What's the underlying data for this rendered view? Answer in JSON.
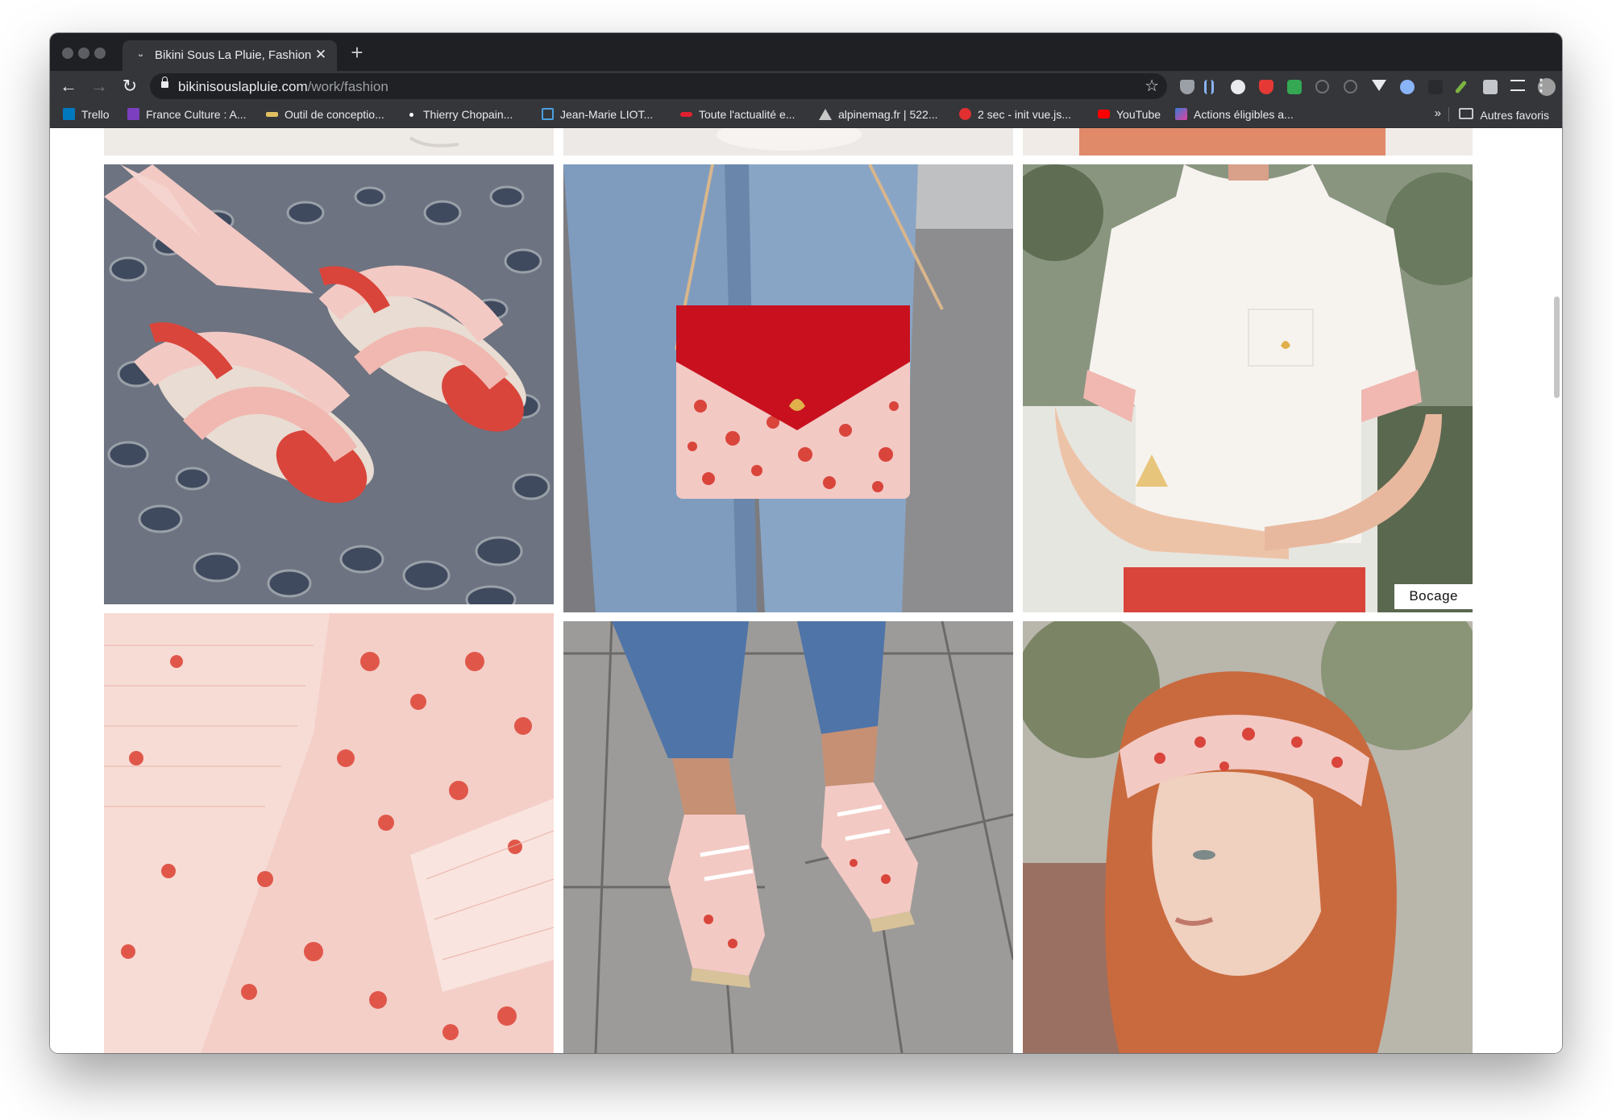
{
  "browser": {
    "tab": {
      "title": "Bikini Sous La Pluie, Fashion",
      "favicon": "mustache-icon",
      "close": "✕",
      "new_tab": "+"
    },
    "nav": {
      "back": "←",
      "forward": "→",
      "reload": "↻"
    },
    "address": {
      "host": "bikinisouslapluie.com",
      "path": "/work/fashion"
    },
    "star": "☆",
    "menu": "⋮",
    "extensions": [
      "shield-badge-0",
      "bar-chart",
      "skull",
      "red-shield",
      "green-badge-2",
      "recycle",
      "clock",
      "v-logo",
      "blue-ring",
      "dark-square",
      "pencil",
      "puzzle",
      "playlist",
      "profile-avatar"
    ]
  },
  "bookmarks": {
    "items": [
      {
        "label": "Trello",
        "icon_color": "#0079bf"
      },
      {
        "label": "France Culture : A...",
        "icon_color": "#7b3fbf"
      },
      {
        "label": "Outil de conceptio...",
        "icon_color": "#e0c060"
      },
      {
        "label": "Thierry Chopain...",
        "icon_color": "#ffffff"
      },
      {
        "label": "Jean-Marie LIOT...",
        "icon_color": "#4aa0e0"
      },
      {
        "label": "Toute l'actualité e...",
        "icon_color": "#e02030"
      },
      {
        "label": "alpinemag.fr | 522...",
        "icon_color": "#c8c8c8"
      },
      {
        "label": "2 sec - init vue.js...",
        "icon_color": "#e03030"
      },
      {
        "label": "YouTube",
        "icon_color": "#ff0000"
      },
      {
        "label": "Actions éligibles a...",
        "icon_color": "#e040a0"
      }
    ],
    "overflow": "»",
    "other_folder": "Autres favoris"
  },
  "gallery": {
    "captions": {
      "tshirt": "Bocage"
    },
    "images": [
      "top-partial-1",
      "top-partial-2",
      "top-partial-3",
      "sandals-on-pebbles",
      "red-clutch-bag",
      "white-tshirt",
      "floral-fabric",
      "floral-sneakers",
      "floral-headband"
    ]
  },
  "colors": {
    "chrome_dark": "#1f2023",
    "toolbar": "#35363a",
    "accent_red": "#d9453b",
    "print_pink": "#f3c9c4"
  }
}
